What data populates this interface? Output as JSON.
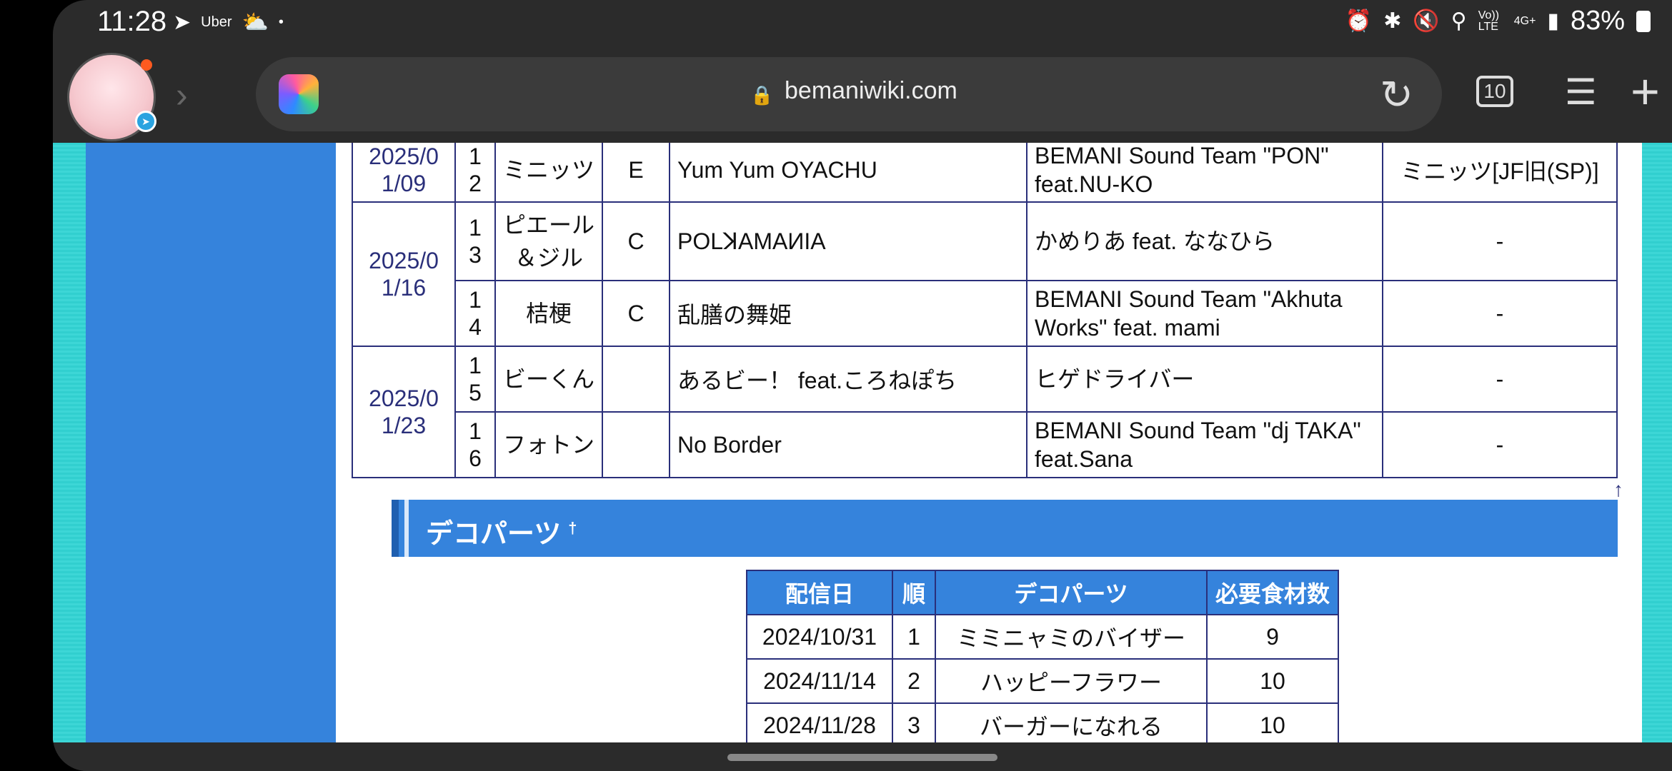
{
  "status": {
    "time": "11:28",
    "uber": "Uber",
    "dot": "•",
    "battery": "83%",
    "lte": "Vo)) LTE",
    "net": "4G+"
  },
  "browser": {
    "url": "bemaniwiki.com",
    "tab_count": "10"
  },
  "songs_table": {
    "rows": [
      {
        "date": "2025/0 1/09",
        "num": "1 2",
        "chara": "ミニッツ",
        "diff": "E",
        "title": "Yum Yum OYACHU",
        "artist": "BEMANI Sound Team \"PON\" feat.NU-KO",
        "unlock": "ミニッツ[JF旧(SP)]"
      },
      {
        "date": "2025/0 1/16",
        "num": "1 3",
        "chara": "ピエール＆ジル",
        "diff": "C",
        "title": "POLꓘAMAИIA",
        "artist": "かめりあ feat. ななひら",
        "unlock": "-"
      },
      {
        "num": "1 4",
        "chara": "桔梗",
        "diff": "C",
        "title": "乱膳の舞姫",
        "artist": "BEMANI Sound Team \"Akhuta Works\" feat. mami",
        "unlock": "-"
      },
      {
        "date": "2025/0 1/23",
        "num": "1 5",
        "chara": "ビーくん",
        "diff": "",
        "title": "あるビー！ feat.ころねぽち",
        "artist": "ヒゲドライバー",
        "unlock": "-"
      },
      {
        "num": "1 6",
        "chara": "フォトン",
        "diff": "",
        "title": "No Border",
        "artist": "BEMANI Sound Team \"dj TAKA\" feat.Sana",
        "unlock": "-"
      }
    ]
  },
  "up_arrow": "↑",
  "deco_section": {
    "heading": "デコパーツ",
    "anchor": "†",
    "headers": [
      "配信日",
      "順",
      "デコパーツ",
      "必要食材数"
    ],
    "rows": [
      [
        "2024/10/31",
        "1",
        "ミミニャミのバイザー",
        "9"
      ],
      [
        "2024/11/14",
        "2",
        "ハッピーフラワー",
        "10"
      ],
      [
        "2024/11/28",
        "3",
        "バーガーになれる",
        "10"
      ]
    ]
  }
}
